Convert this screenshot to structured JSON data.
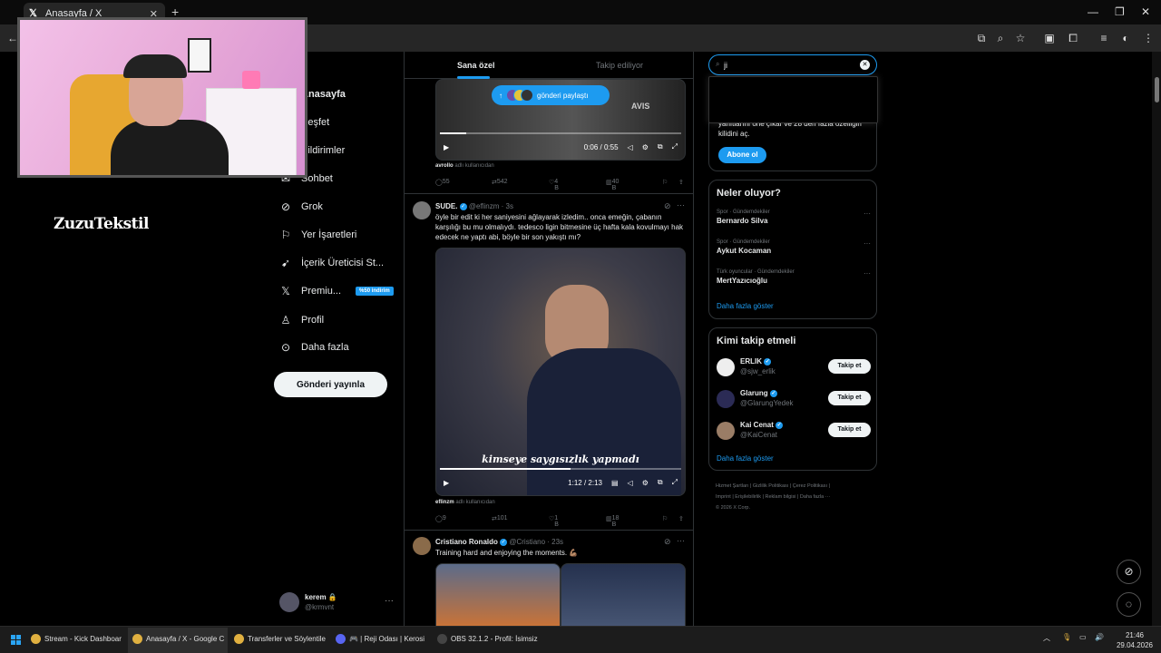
{
  "browser": {
    "tab_title": "Anasayfa / X",
    "new_tab": "+",
    "tab_close": "✕"
  },
  "brand": "ZuzuTekstil",
  "nav": {
    "items": [
      {
        "label": "Anasayfa",
        "icon": "home-icon"
      },
      {
        "label": "Keşfet",
        "icon": "search-icon"
      },
      {
        "label": "Bildirimler",
        "icon": "bell-icon"
      },
      {
        "label": "Sohbet",
        "icon": "chat-icon"
      },
      {
        "label": "Grok",
        "icon": "grok-icon"
      },
      {
        "label": "Yer İşaretleri",
        "icon": "bookmark-icon"
      },
      {
        "label": "İçerik Üreticisi St...",
        "icon": "rocket-icon"
      },
      {
        "label": "Premiu...",
        "icon": "x-icon",
        "badge": "%50 indirim"
      },
      {
        "label": "Profil",
        "icon": "person-icon"
      },
      {
        "label": "Daha fazla",
        "icon": "more-icon"
      }
    ],
    "post_button": "Gönderi yayınla"
  },
  "account": {
    "name": "kerem",
    "lock": "🔒",
    "handle": "@krmvnt",
    "more": "···"
  },
  "feed": {
    "tabs": [
      "Sana özel",
      "Takip ediliyor"
    ],
    "share_pill": "gönderi paylaştı",
    "video1": {
      "time": "0:06 / 0:55",
      "progress": 0.11,
      "overlay_text": "AVIS"
    },
    "post1_source": {
      "user": "avrollo",
      "suffix": " adlı kullanıcıdan"
    },
    "post1_actions": {
      "replies": "55",
      "reposts": "542",
      "likes": "4 B",
      "views": "40 B"
    },
    "post2": {
      "name": "SUDE.",
      "handle": "@eflinzm · 3s",
      "text": "öyle bir edit ki her saniyesini ağlayarak izledim.. onca emeğin, çabanın karşılığı bu mu olmalıydı. tedesco ligin bitmesine üç hafta kala kovulmayı hak edecek ne yaptı abi, böyle bir son yakıştı mı?",
      "caption": "kimseye saygısızlık yapmadı",
      "time": "1:12 / 2:13",
      "progress": 0.54,
      "source_user": "eflinzm",
      "source_suffix": " adlı kullanıcıdan",
      "replies": "9",
      "reposts": "101",
      "likes": "1 B",
      "views": "18 B"
    },
    "post3": {
      "name": "Cristiano Ronaldo",
      "handle": "@Cristiano · 23s",
      "text": "Training hard and enjoying the moments. 💪🏽"
    }
  },
  "search": {
    "value": "ji",
    "icon": "search-icon"
  },
  "premium_card": {
    "text": "yanıtlarını öne çıkar ve 28 den fazla özelliğin kilidini aç.",
    "button": "Abone ol"
  },
  "trends": {
    "title": "Neler oluyor?",
    "items": [
      {
        "meta": "Spor · Gündemdekiler",
        "name": "Bernardo Silva"
      },
      {
        "meta": "Spor · Gündemdekiler",
        "name": "Aykut Kocaman"
      },
      {
        "meta": "Türk oyuncular · Gündemdekiler",
        "name": "MertYazıcıoğlu"
      }
    ],
    "more": "Daha fazla göster"
  },
  "who_to_follow": {
    "title": "Kimi takip etmeli",
    "items": [
      {
        "name": "ERLIK",
        "handle": "@sjw_erlik",
        "button": "Takip et"
      },
      {
        "name": "Glarung",
        "handle": "@GlarungYedek",
        "button": "Takip et"
      },
      {
        "name": "Kai Cenat",
        "handle": "@KaiCenat",
        "button": "Takip et"
      }
    ],
    "more": "Daha fazla göster"
  },
  "footer": {
    "line1": "Hizmet Şartları  |  Gizlilik Politikası  |  Çerez Politikası  |",
    "line2": "Imprint  |  Erişilebilirlik  |  Reklam bilgisi  |  Daha fazla ···",
    "line3": "© 2026 X Corp."
  },
  "taskbar": {
    "items": [
      "Stream - Kick Dashboar",
      "Anasayfa / X - Google C",
      "Transferler ve Söylentile",
      "🎮 | Reji Odası | Kerosi",
      "OBS 32.1.2 - Profil: İsimsiz"
    ],
    "time": "21:46",
    "date": "29.04.2026"
  }
}
